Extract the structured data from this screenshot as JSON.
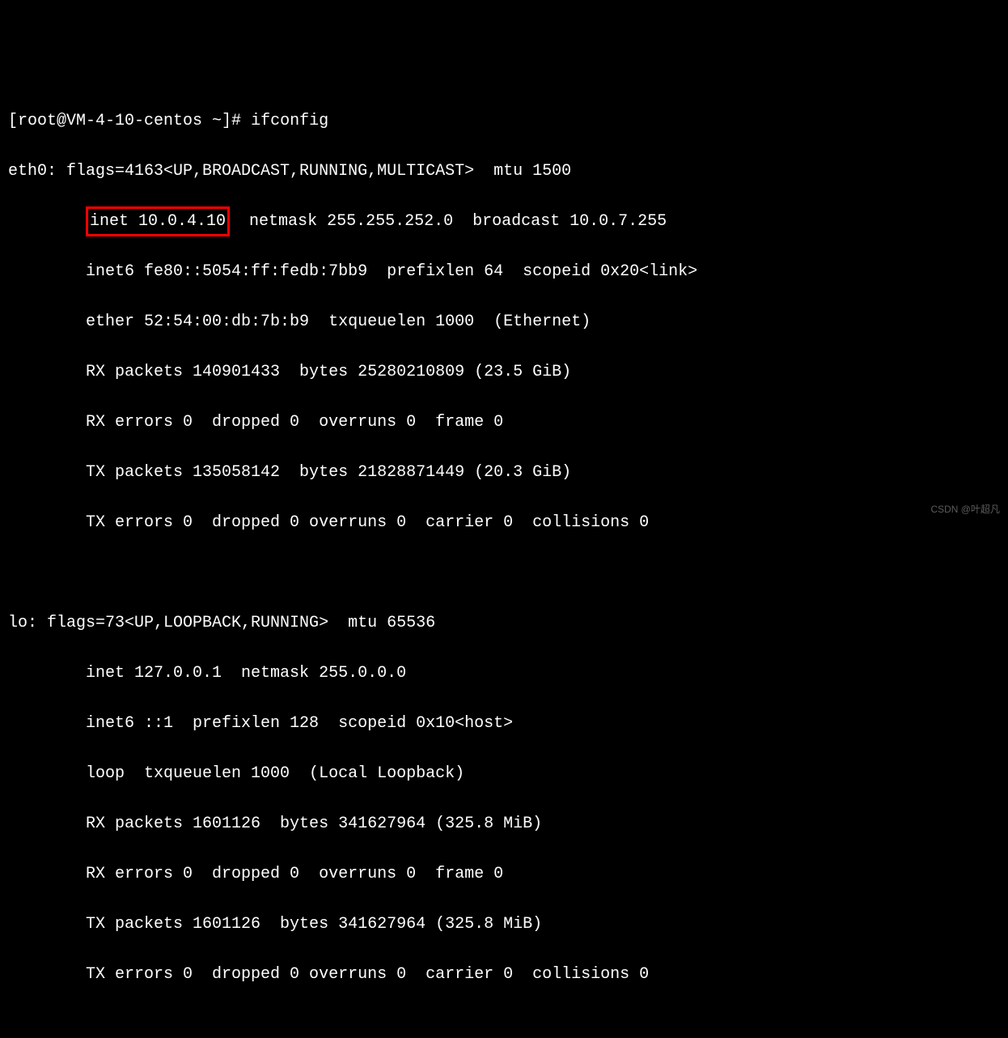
{
  "prompt": {
    "user_host": "[root@VM-4-10-centos ~]# ",
    "command": "ifconfig"
  },
  "eth0": {
    "header": "eth0: flags=4163<UP,BROADCAST,RUNNING,MULTICAST>  mtu 1500",
    "inet_highlight": "inet 10.0.4.10",
    "inet_rest": "  netmask 255.255.252.0  broadcast 10.0.7.255",
    "inet6": "        inet6 fe80::5054:ff:fedb:7bb9  prefixlen 64  scopeid 0x20<link>",
    "ether": "        ether 52:54:00:db:7b:b9  txqueuelen 1000  (Ethernet)",
    "rx_packets": "        RX packets 140901433  bytes 25280210809 (23.5 GiB)",
    "rx_errors": "        RX errors 0  dropped 0  overruns 0  frame 0",
    "tx_packets": "        TX packets 135058142  bytes 21828871449 (20.3 GiB)",
    "tx_errors": "        TX errors 0  dropped 0 overruns 0  carrier 0  collisions 0"
  },
  "lo": {
    "header": "lo: flags=73<UP,LOOPBACK,RUNNING>  mtu 65536",
    "inet": "        inet 127.0.0.1  netmask 255.0.0.0",
    "inet6": "        inet6 ::1  prefixlen 128  scopeid 0x10<host>",
    "loop": "        loop  txqueuelen 1000  (Local Loopback)",
    "rx_packets": "        RX packets 1601126  bytes 341627964 (325.8 MiB)",
    "rx_errors": "        RX errors 0  dropped 0  overruns 0  frame 0",
    "tx_packets": "        TX packets 1601126  bytes 341627964 (325.8 MiB)",
    "tx_errors": "        TX errors 0  dropped 0 overruns 0  carrier 0  collisions 0"
  },
  "indent_inet": "        ",
  "watermark": "CSDN @叶超凡"
}
